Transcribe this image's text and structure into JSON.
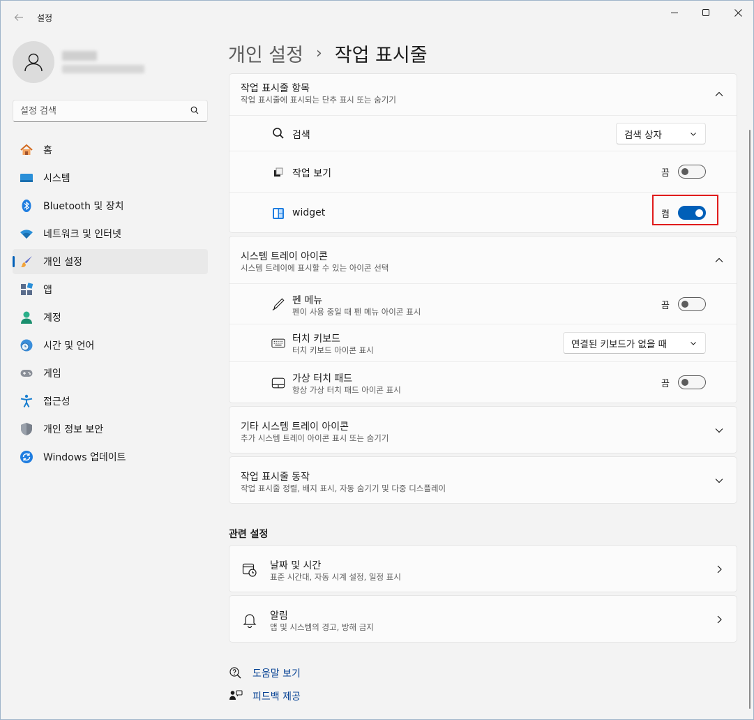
{
  "window": {
    "app_title": "설정"
  },
  "sidebar": {
    "search_placeholder": "설정 검색",
    "items": [
      {
        "label": "홈",
        "icon": "home-icon"
      },
      {
        "label": "시스템",
        "icon": "system-icon"
      },
      {
        "label": "Bluetooth 및 장치",
        "icon": "bluetooth-icon"
      },
      {
        "label": "네트워크 및 인터넷",
        "icon": "network-icon"
      },
      {
        "label": "개인 설정",
        "icon": "brush-icon",
        "active": true
      },
      {
        "label": "앱",
        "icon": "apps-icon"
      },
      {
        "label": "계정",
        "icon": "account-icon"
      },
      {
        "label": "시간 및 언어",
        "icon": "time-language-icon"
      },
      {
        "label": "게임",
        "icon": "gaming-icon"
      },
      {
        "label": "접근성",
        "icon": "accessibility-icon"
      },
      {
        "label": "개인 정보 보안",
        "icon": "shield-icon"
      },
      {
        "label": "Windows 업데이트",
        "icon": "update-icon"
      }
    ]
  },
  "breadcrumb": {
    "parent": "개인 설정",
    "separator": "›",
    "current": "작업 표시줄"
  },
  "taskbar_items": {
    "title": "작업 표시줄 항목",
    "subtitle": "작업 표시줄에 표시되는 단추 표시 또는 숨기기",
    "rows": [
      {
        "label": "검색",
        "control": "dropdown",
        "value": "검색 상자"
      },
      {
        "label": "작업 보기",
        "control": "toggle",
        "state": "끔",
        "on": false
      },
      {
        "label": "widget",
        "control": "toggle",
        "state": "켬",
        "on": true
      }
    ]
  },
  "tray_icons": {
    "title": "시스템 트레이 아이콘",
    "subtitle": "시스템 트레이에 표시할 수 있는 아이콘 선택",
    "rows": [
      {
        "label": "펜 메뉴",
        "sub": "펜이 사용 중일 때 펜 메뉴 아이콘 표시",
        "control": "toggle",
        "state": "끔"
      },
      {
        "label": "터치 키보드",
        "sub": "터치 키보드 아이콘 표시",
        "control": "dropdown",
        "value": "연결된 키보드가 없을 때"
      },
      {
        "label": "가상 터치 패드",
        "sub": "항상 가상 터치 패드 아이콘 표시",
        "control": "toggle",
        "state": "끔"
      }
    ]
  },
  "other_tray": {
    "title": "기타 시스템 트레이 아이콘",
    "subtitle": "추가 시스템 트레이 아이콘 표시 또는 숨기기"
  },
  "behaviors": {
    "title": "작업 표시줄 동작",
    "subtitle": "작업 표시줄 정렬, 배지 표시, 자동 숨기기 및 다중 디스플레이"
  },
  "related": {
    "heading": "관련 설정",
    "items": [
      {
        "label": "날짜 및 시간",
        "sub": "표준 시간대, 자동 시계 설정, 일정 표시"
      },
      {
        "label": "알림",
        "sub": "앱 및 시스템의 경고, 방해 금지"
      }
    ]
  },
  "footer_links": {
    "help": "도움말 보기",
    "feedback": "피드백 제공"
  },
  "colors": {
    "accent": "#005fb8",
    "highlight": "#e01b1b"
  }
}
